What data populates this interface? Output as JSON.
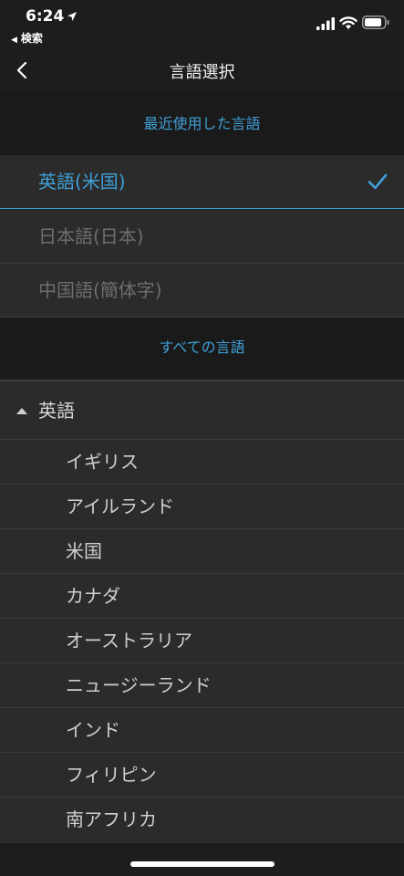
{
  "status_bar": {
    "time": "6:24",
    "back_app": "検索"
  },
  "nav": {
    "title": "言語選択"
  },
  "recent_section": {
    "header": "最近使用した言語",
    "items": [
      {
        "label": "英語(米国)",
        "selected": true
      },
      {
        "label": "日本語(日本)",
        "selected": false
      },
      {
        "label": "中国語(簡体字)",
        "selected": false
      }
    ]
  },
  "all_section": {
    "header": "すべての言語",
    "group": {
      "label": "英語",
      "expanded": true,
      "items": [
        "イギリス",
        "アイルランド",
        "米国",
        "カナダ",
        "オーストラリア",
        "ニュージーランド",
        "インド",
        "フィリピン",
        "南アフリカ"
      ]
    }
  },
  "colors": {
    "accent": "#3fa0d8",
    "background": "#1d1d1d",
    "row": "#2b2b2b"
  },
  "icons": {
    "location": "location-arrow-icon",
    "signal": "cellular-signal-icon",
    "wifi": "wifi-icon",
    "battery": "battery-icon",
    "back": "chevron-left-icon",
    "check": "checkmark-icon",
    "caret": "caret-up-icon"
  }
}
